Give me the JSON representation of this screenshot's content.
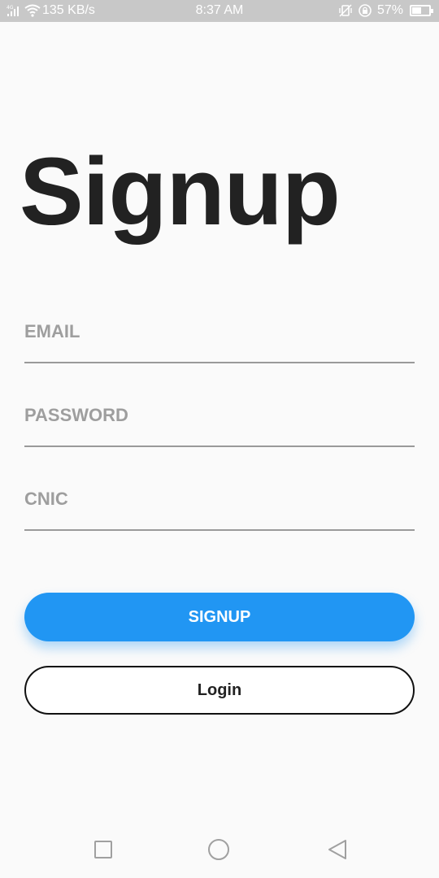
{
  "status_bar": {
    "network": "4G",
    "speed": "135 KB/s",
    "time": "8:37 AM",
    "battery": "57%",
    "battery_level": 0.57
  },
  "title": "Signup",
  "fields": {
    "email_label": "EMAIL",
    "password_label": "PASSWORD",
    "cnic_label": "CNIC"
  },
  "buttons": {
    "signup_label": "SIGNUP",
    "login_label": "Login"
  },
  "colors": {
    "primary": "#2196f3",
    "background": "#fafafa",
    "title": "#222222",
    "label": "#9e9e9e"
  },
  "nav_icons": [
    "recent-apps-icon",
    "home-icon",
    "back-icon"
  ]
}
